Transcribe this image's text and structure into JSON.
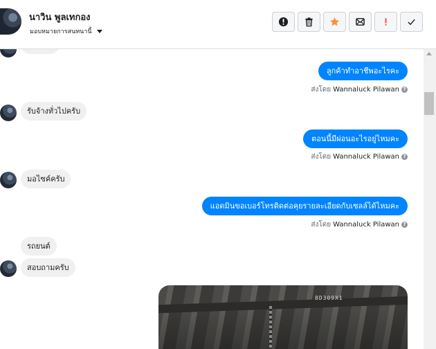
{
  "header": {
    "contact_name": "นาวิน พูลเทกอง",
    "assign_label": "มอบหมายการสนทนานี้",
    "actions": [
      {
        "name": "spam-button",
        "icon": "exclamation-circle-icon"
      },
      {
        "name": "delete-button",
        "icon": "trash-icon"
      },
      {
        "name": "star-button",
        "icon": "star-icon",
        "color": "#f7923b"
      },
      {
        "name": "unread-button",
        "icon": "envelope-icon"
      },
      {
        "name": "follow-up-button",
        "icon": "exclamation-icon",
        "color": "#fa3e3e"
      },
      {
        "name": "done-button",
        "icon": "check-icon"
      }
    ]
  },
  "messages": [
    {
      "direction": "out",
      "text": "ลูกค้าทำอาชีพอะไรคะ",
      "sent_prefix": "ส่งโดย",
      "sender": "Wannaluck Pilawan"
    },
    {
      "direction": "in",
      "text": "รับจ้างทั่วไปครับ"
    },
    {
      "direction": "out",
      "text": "ตอนนี้มีผ่อนอะไรอยู่ไหมคะ",
      "sent_prefix": "ส่งโดย",
      "sender": "Wannaluck Pilawan"
    },
    {
      "direction": "in",
      "text": "มอไซค์ครับ"
    },
    {
      "direction": "out",
      "text": "แอดมินขอเบอร์โทรติดต่อคุยรายละเอียดกับเซลล์ได้ไหมคะ",
      "sent_prefix": "ส่งโดย",
      "sender": "Wannaluck Pilawan"
    },
    {
      "direction": "in",
      "text": "รถยนต์"
    },
    {
      "direction": "in",
      "text": "สอบถามครับ"
    }
  ],
  "photo": {
    "plate_text": "8D309X1"
  },
  "colors": {
    "outgoing": "#0084ff",
    "incoming": "#f1f0f0",
    "star": "#f7923b",
    "alert": "#fa3e3e"
  }
}
